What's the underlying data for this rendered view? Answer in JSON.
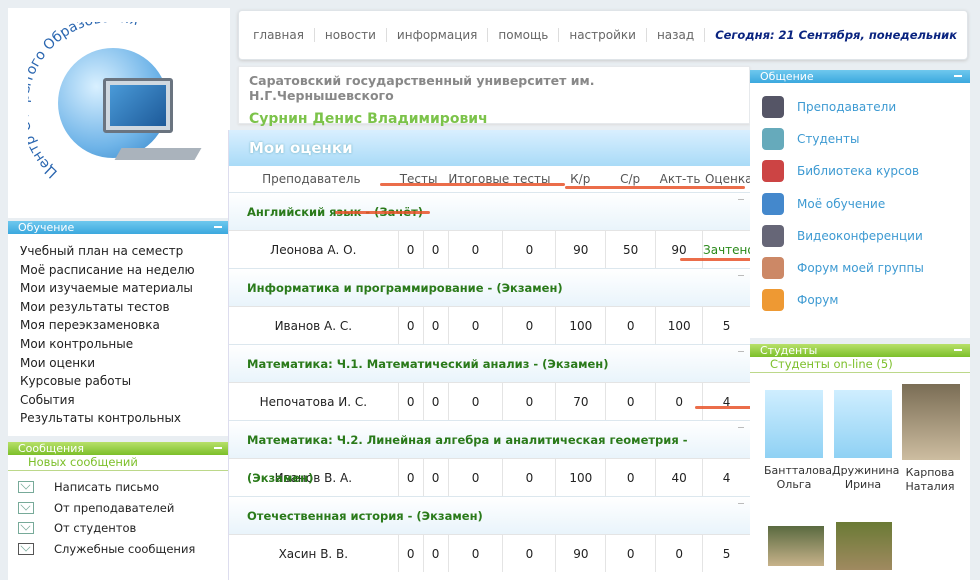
{
  "logo": {
    "text": "Центр Открытого Образования"
  },
  "nav": {
    "links": [
      "главная",
      "новости",
      "информация",
      "помощь",
      "настройки",
      "назад"
    ],
    "today": "Сегодня: 21 Сентября, понедельник"
  },
  "user": {
    "university": "Саратовский государственный университет им. Н.Г.Чернышевского",
    "name": "Сурнин Денис Владимирович"
  },
  "study": {
    "title": "Обучение",
    "items": [
      "Учебный план на семестр",
      "Моё расписание на неделю",
      "Мои изучаемые материалы",
      "Мои результаты тестов",
      "Моя переэкзаменовка",
      "Мои контрольные",
      "Мои оценки",
      "Курсовые работы",
      "События",
      "Результаты контрольных"
    ]
  },
  "messages": {
    "title": "Сообщения",
    "new_label": "Новых сообщений",
    "items": [
      {
        "label": "Написать письмо",
        "icon": "write-letter-icon"
      },
      {
        "label": "От преподавателей",
        "icon": "envelope-icon"
      },
      {
        "label": "От студентов",
        "icon": "envelope-icon"
      },
      {
        "label": "Служебные сообщения",
        "icon": "envelope-icon"
      }
    ]
  },
  "grades": {
    "title": "Мои оценки",
    "columns": [
      "Преподаватель",
      "Тесты",
      "Итоговые тесты",
      "К/р",
      "С/р",
      "Акт-ть",
      "Оценка"
    ],
    "subjects": [
      {
        "name": "Английский язык - (Зачёт)",
        "row": [
          "Леонова А. О.",
          "0",
          "0",
          "0",
          "0",
          "90",
          "50",
          "90",
          "Зачтено"
        ]
      },
      {
        "name": "Информатика и программирование - (Экзамен)",
        "row": [
          "Иванов А. С.",
          "0",
          "0",
          "0",
          "0",
          "100",
          "0",
          "100",
          "5"
        ]
      },
      {
        "name": "Математика: Ч.1. Математический анализ - (Экзамен)",
        "row": [
          "Непочатова И. С.",
          "0",
          "0",
          "0",
          "0",
          "70",
          "0",
          "0",
          "4"
        ]
      },
      {
        "name": "Математика: Ч.2. Линейная алгебра и аналитическая геометрия - (Экзамен)",
        "row": [
          "Иванов В. А.",
          "0",
          "0",
          "0",
          "0",
          "100",
          "0",
          "40",
          "4"
        ]
      },
      {
        "name": "Отечественная история - (Экзамен)",
        "row": [
          "Хасин В. В.",
          "0",
          "0",
          "0",
          "0",
          "90",
          "0",
          "0",
          "5"
        ]
      }
    ]
  },
  "communication": {
    "title": "Общение",
    "items": [
      {
        "label": "Преподаватели",
        "icon": "teacher-icon",
        "color": "#556"
      },
      {
        "label": "Студенты",
        "icon": "students-icon",
        "color": "#6ab"
      },
      {
        "label": "Библиотека курсов",
        "icon": "books-icon",
        "color": "#c44"
      },
      {
        "label": "Моё обучение",
        "icon": "book-icon",
        "color": "#48c"
      },
      {
        "label": "Видеоконференции",
        "icon": "camera-icon",
        "color": "#667"
      },
      {
        "label": "Форум моей группы",
        "icon": "group-forum-icon",
        "color": "#c86"
      },
      {
        "label": "Форум",
        "icon": "forum-icon",
        "color": "#e93"
      }
    ]
  },
  "students": {
    "title": "Студенты",
    "online_label": "Студенты on-line (5)",
    "people": [
      {
        "first": "Бантталова",
        "last": "Ольга"
      },
      {
        "first": "Дружинина",
        "last": "Ирина"
      },
      {
        "first": "Карпова",
        "last": "Наталия"
      }
    ]
  }
}
